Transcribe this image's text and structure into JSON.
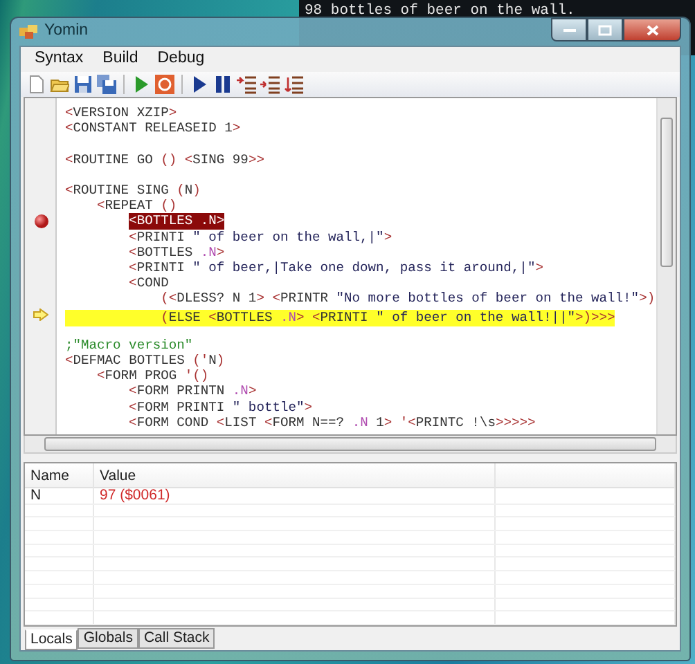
{
  "background_console": {
    "text": "98 bottles of beer on the wall."
  },
  "window": {
    "title": "Yomin"
  },
  "menu": [
    {
      "label": "Syntax"
    },
    {
      "label": "Build"
    },
    {
      "label": "Debug"
    }
  ],
  "editor": {
    "lines": [
      {
        "breakpoint": false,
        "current": false,
        "tokens": [
          {
            "text": "<",
            "kind": "punct"
          },
          {
            "text": "VERSION XZIP",
            "kind": "name"
          },
          {
            "text": ">",
            "kind": "punct"
          }
        ]
      },
      {
        "breakpoint": false,
        "current": false,
        "tokens": [
          {
            "text": "<",
            "kind": "punct"
          },
          {
            "text": "CONSTANT RELEASEID 1",
            "kind": "name"
          },
          {
            "text": ">",
            "kind": "punct"
          }
        ]
      },
      {
        "breakpoint": false,
        "current": false
      },
      {
        "breakpoint": false,
        "current": false,
        "tokens": [
          {
            "text": "<",
            "kind": "punct"
          },
          {
            "text": "ROUTINE GO ",
            "kind": "name"
          },
          {
            "text": "() <",
            "kind": "punct"
          },
          {
            "text": "SING 99",
            "kind": "name"
          },
          {
            "text": ">>",
            "kind": "punct"
          }
        ]
      },
      {
        "breakpoint": false,
        "current": false
      },
      {
        "breakpoint": false,
        "current": false,
        "tokens": [
          {
            "text": "<",
            "kind": "punct"
          },
          {
            "text": "ROUTINE SING ",
            "kind": "name"
          },
          {
            "text": "(",
            "kind": "punct"
          },
          {
            "text": "N",
            "kind": "name"
          },
          {
            "text": ")",
            "kind": "punct"
          }
        ]
      },
      {
        "breakpoint": false,
        "current": false,
        "tokens": [
          {
            "text": "    <",
            "kind": "punct"
          },
          {
            "text": "REPEAT ",
            "kind": "name"
          },
          {
            "text": "()",
            "kind": "punct"
          }
        ]
      },
      {
        "breakpoint": true,
        "current": false,
        "tokens": [
          {
            "text": "        <",
            "kind": "punct"
          },
          {
            "text": "BOTTLES ",
            "kind": "name"
          },
          {
            "text": ".N",
            "kind": "local"
          },
          {
            "text": ">",
            "kind": "punct"
          }
        ]
      },
      {
        "breakpoint": false,
        "current": false,
        "tokens": [
          {
            "text": "        <",
            "kind": "punct"
          },
          {
            "text": "PRINTI ",
            "kind": "name"
          },
          {
            "text": "\" of beer on the wall,|\"",
            "kind": "string"
          },
          {
            "text": ">",
            "kind": "punct"
          }
        ]
      },
      {
        "breakpoint": false,
        "current": false,
        "tokens": [
          {
            "text": "        <",
            "kind": "punct"
          },
          {
            "text": "BOTTLES ",
            "kind": "name"
          },
          {
            "text": ".N",
            "kind": "local"
          },
          {
            "text": ">",
            "kind": "punct"
          }
        ]
      },
      {
        "breakpoint": false,
        "current": false,
        "tokens": [
          {
            "text": "        <",
            "kind": "punct"
          },
          {
            "text": "PRINTI ",
            "kind": "name"
          },
          {
            "text": "\" of beer,|Take one down, pass it around,|\"",
            "kind": "string"
          },
          {
            "text": ">",
            "kind": "punct"
          }
        ]
      },
      {
        "breakpoint": false,
        "current": false,
        "tokens": [
          {
            "text": "        <",
            "kind": "punct"
          },
          {
            "text": "COND",
            "kind": "name"
          }
        ]
      },
      {
        "breakpoint": false,
        "current": false,
        "tokens": [
          {
            "text": "            (<",
            "kind": "punct"
          },
          {
            "text": "DLESS? N 1",
            "kind": "name"
          },
          {
            "text": "> <",
            "kind": "punct"
          },
          {
            "text": "PRINTR ",
            "kind": "name"
          },
          {
            "text": "\"No more bottles of beer on the wall!\"",
            "kind": "string"
          },
          {
            "text": ">)",
            "kind": "punct"
          }
        ]
      },
      {
        "breakpoint": false,
        "current": true,
        "tokens": [
          {
            "text": "            (",
            "kind": "punct"
          },
          {
            "text": "ELSE ",
            "kind": "name"
          },
          {
            "text": "<",
            "kind": "punct"
          },
          {
            "text": "BOTTLES ",
            "kind": "name"
          },
          {
            "text": ".N",
            "kind": "local"
          },
          {
            "text": "> <",
            "kind": "punct"
          },
          {
            "text": "PRINTI ",
            "kind": "name"
          },
          {
            "text": "\" of beer on the wall!||\"",
            "kind": "string"
          },
          {
            "text": ">)>>>",
            "kind": "punct"
          }
        ]
      },
      {
        "breakpoint": false,
        "current": false
      },
      {
        "breakpoint": false,
        "current": false,
        "tokens": [
          {
            "text": ";\"Macro version\"",
            "kind": "comment"
          }
        ]
      },
      {
        "breakpoint": false,
        "current": false,
        "tokens": [
          {
            "text": "<",
            "kind": "punct"
          },
          {
            "text": "DEFMAC BOTTLES ",
            "kind": "name"
          },
          {
            "text": "('",
            "kind": "punct"
          },
          {
            "text": "N",
            "kind": "name"
          },
          {
            "text": ")",
            "kind": "punct"
          }
        ]
      },
      {
        "breakpoint": false,
        "current": false,
        "tokens": [
          {
            "text": "    <",
            "kind": "punct"
          },
          {
            "text": "FORM PROG ",
            "kind": "name"
          },
          {
            "text": "'()",
            "kind": "punct"
          }
        ]
      },
      {
        "breakpoint": false,
        "current": false,
        "tokens": [
          {
            "text": "        <",
            "kind": "punct"
          },
          {
            "text": "FORM PRINTN ",
            "kind": "name"
          },
          {
            "text": ".N",
            "kind": "local"
          },
          {
            "text": ">",
            "kind": "punct"
          }
        ]
      },
      {
        "breakpoint": false,
        "current": false,
        "tokens": [
          {
            "text": "        <",
            "kind": "punct"
          },
          {
            "text": "FORM PRINTI ",
            "kind": "name"
          },
          {
            "text": "\" bottle\"",
            "kind": "string"
          },
          {
            "text": ">",
            "kind": "punct"
          }
        ]
      },
      {
        "breakpoint": false,
        "current": false,
        "tokens": [
          {
            "text": "        <",
            "kind": "punct"
          },
          {
            "text": "FORM COND ",
            "kind": "name"
          },
          {
            "text": "<",
            "kind": "punct"
          },
          {
            "text": "LIST ",
            "kind": "name"
          },
          {
            "text": "<",
            "kind": "punct"
          },
          {
            "text": "FORM N==? ",
            "kind": "name"
          },
          {
            "text": ".N",
            "kind": "local"
          },
          {
            "text": " 1",
            "kind": "name"
          },
          {
            "text": "> '<",
            "kind": "punct"
          },
          {
            "text": "PRINTC !\\s",
            "kind": "name"
          },
          {
            "text": ">>>>>",
            "kind": "punct"
          }
        ]
      }
    ]
  },
  "variables": {
    "columns": [
      "Name",
      "Value"
    ],
    "rows": [
      {
        "name": "N",
        "value": "97 ($0061)"
      }
    ]
  },
  "tabs": [
    {
      "label": "Locals",
      "selected": true
    },
    {
      "label": "Globals",
      "selected": false
    },
    {
      "label": "Call Stack",
      "selected": false
    }
  ]
}
